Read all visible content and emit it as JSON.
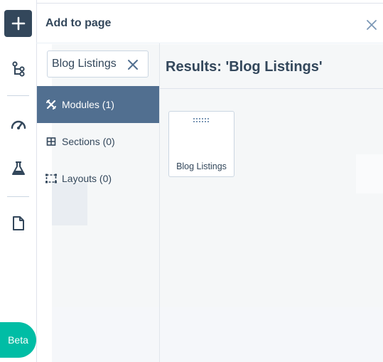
{
  "rail": {
    "add_icon": "plus-icon",
    "icons": [
      "structure-icon",
      "performance-gauge-icon",
      "flask-icon",
      "document-icon"
    ],
    "beta_label": "Beta"
  },
  "panel": {
    "title": "Add to page",
    "close_icon": "close-icon"
  },
  "search": {
    "value": "Blog Listings",
    "clear_icon": "clear-x-icon"
  },
  "nav": [
    {
      "label": "Modules (1)",
      "icon": "modules-icon",
      "active": true
    },
    {
      "label": "Sections (0)",
      "icon": "sections-icon",
      "active": false
    },
    {
      "label": "Layouts (0)",
      "icon": "layouts-icon",
      "active": false
    }
  ],
  "results": {
    "title": "Results: 'Blog Listings'",
    "modules": [
      {
        "label": "Blog Listings",
        "icon": "drag-handle-icon"
      }
    ]
  },
  "colors": {
    "sidebar_active": "#516f90",
    "rail_button": "#33475b",
    "beta": "#00bda5",
    "text": "#33475b"
  }
}
